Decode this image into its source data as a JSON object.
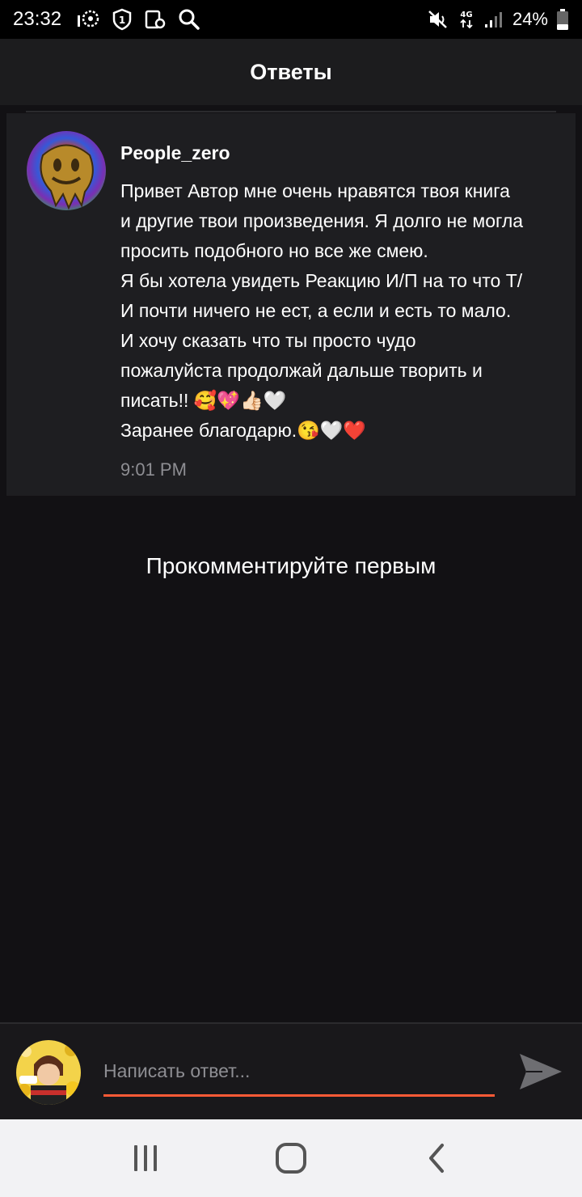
{
  "status_bar": {
    "time": "23:32",
    "battery": "24%",
    "network": "4G",
    "icons_left": [
      "pinwheel-icon",
      "shield-1-icon",
      "notification-icon",
      "search-icon"
    ],
    "icons_right": [
      "mute-icon",
      "network-4g-icon",
      "signal-icon",
      "battery-icon"
    ]
  },
  "header": {
    "title": "Ответы"
  },
  "comment": {
    "author": "People_zero",
    "lines": [
      "Привет Автор мне очень нравятся твоя книга",
      "и другие твои произведения. Я долго не могла",
      "просить подобного но все же смею.",
      "Я бы хотела увидеть Реакцию И/П на то что Т/",
      "И почти ничего не ест, а если и есть то мало.",
      "И хочу сказать что ты просто чудо",
      "пожалуйста продолжай дальше творить и",
      "писать!! 🥰💖👍🏻🤍",
      "Заранее благодарю.😘🤍❤️"
    ],
    "time": "9:01 PM"
  },
  "empty_state": "Прокомментируйте первым",
  "reply": {
    "placeholder": "Написать ответ...",
    "accent_color": "#ff5a36"
  },
  "nav": {
    "icons": [
      "recent-apps-icon",
      "home-icon",
      "back-icon"
    ]
  }
}
